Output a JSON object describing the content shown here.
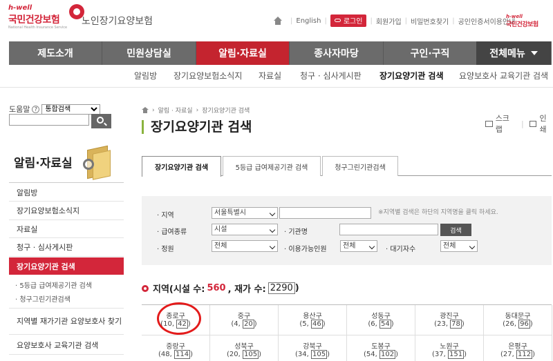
{
  "header": {
    "logo_brand": "h-well",
    "logo_name": "국민건강보험",
    "logo_eng": "National Health Insurance Service",
    "service_name": "노인장기요양보험",
    "util_english": "English",
    "util_login": "로그인",
    "util_join": "회원가입",
    "util_find_pw": "비밀번호찾기",
    "util_cert": "공인인증서이용안내",
    "right_logo_brand": "h-well",
    "right_logo_name": "국민건강보험"
  },
  "gnb": {
    "items": [
      "제도소개",
      "민원상담실",
      "알림·자료실",
      "종사자마당",
      "구인·구직"
    ],
    "all_menu": "전체메뉴",
    "active_index": 2,
    "active_color": "#c4242f"
  },
  "subnav": {
    "items": [
      "알림방",
      "장기요양보험소식지",
      "자료실",
      "청구 · 심사게시판",
      "장기요양기관 검색",
      "요양보호사 교육기관 검색"
    ],
    "active_index": 4
  },
  "left": {
    "help_label": "도움말",
    "search_scope": "통합검색",
    "title": "알림·자료실",
    "menu": [
      "알림방",
      "장기요양보험소식지",
      "자료실",
      "청구 · 심사게시판",
      "장기요양기관 검색"
    ],
    "submenu": [
      "· 5등급 급여제공기관 검색",
      "· 청구그린기관검색"
    ],
    "menu_after": [
      "지역별 재가기관 요양보호사 찾기",
      "요양보호사 교육기관 검색"
    ],
    "active_index": 4
  },
  "content": {
    "breadcrumb": [
      "알림 · 자료실",
      "장기요양기관 검색"
    ],
    "title": "장기요양기관 검색",
    "scrap": "스크랩",
    "print": "인쇄",
    "tabs": [
      "장기요양기관 검색",
      "5등급 급여제공기관 검색",
      "청구그린기관검색"
    ],
    "active_tab": 0
  },
  "filter": {
    "region_label": "· 지역",
    "region_value": "서울특별시",
    "region_note": "※지역별 검색은 하단의 지역명을 클릭 하세요.",
    "type_label": "· 급여종류",
    "type_value": "시설",
    "org_label": "· 기관명",
    "search_button": "검색",
    "capacity_label": "· 정원",
    "capacity_value": "전체",
    "available_label": "· 이용가능인원",
    "available_value": "전체",
    "waiting_label": "· 대기자수",
    "waiting_value": "전체"
  },
  "regions": {
    "header_prefix": "지역(시설 수:",
    "facility_count": "560",
    "home_label": ", 재가 수:",
    "home_count": "2290",
    "header_suffix": ")",
    "cells": [
      {
        "name": "종로구",
        "a": "10",
        "b": "42"
      },
      {
        "name": "중구",
        "a": "4",
        "b": "20"
      },
      {
        "name": "용산구",
        "a": "5",
        "b": "46"
      },
      {
        "name": "성동구",
        "a": "6",
        "b": "54"
      },
      {
        "name": "광진구",
        "a": "23",
        "b": "78"
      },
      {
        "name": "동대문구",
        "a": "26",
        "b": "96"
      },
      {
        "name": "중랑구",
        "a": "48",
        "b": "114"
      },
      {
        "name": "성북구",
        "a": "20",
        "b": "105"
      },
      {
        "name": "강북구",
        "a": "34",
        "b": "105"
      },
      {
        "name": "도봉구",
        "a": "54",
        "b": "102"
      },
      {
        "name": "노원구",
        "a": "37",
        "b": "151"
      },
      {
        "name": "은평구",
        "a": "27",
        "b": "112"
      }
    ],
    "highlight_index": 0,
    "highlight_color": "#e31b1b"
  }
}
